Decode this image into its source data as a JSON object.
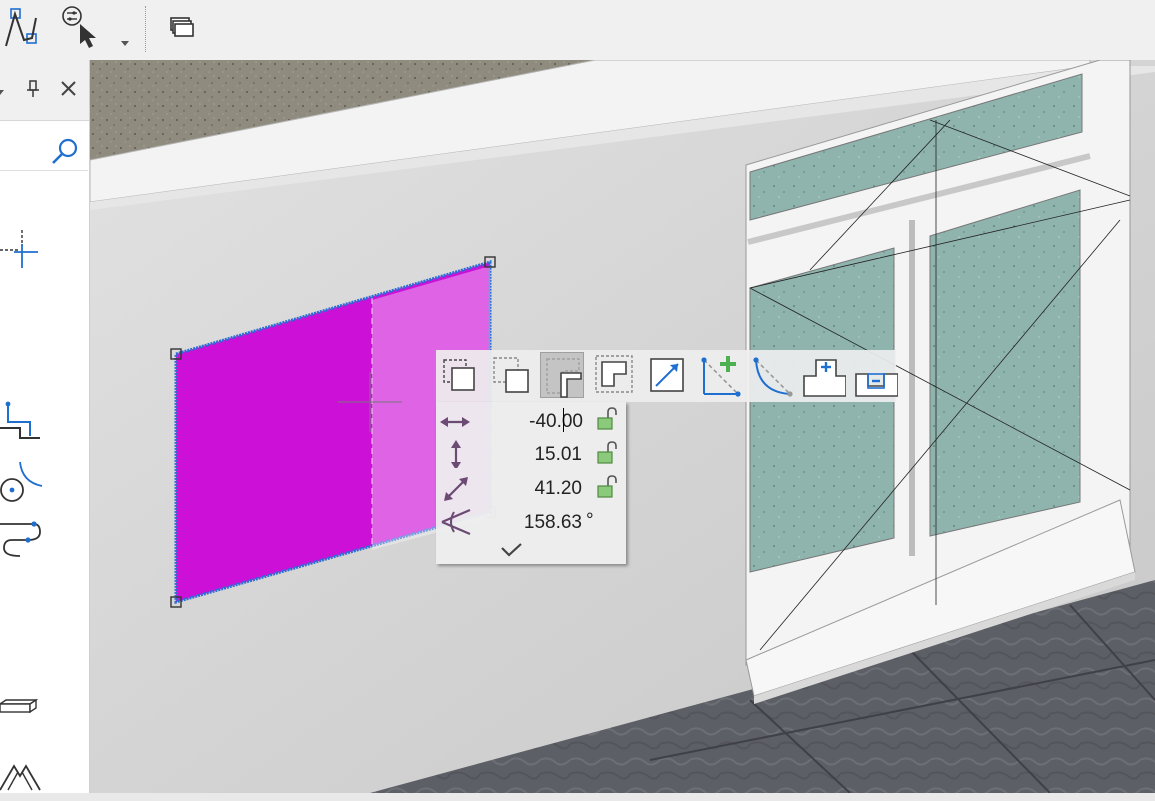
{
  "toolbar": {
    "buttons": [
      {
        "name": "polyline-tool-icon"
      },
      {
        "name": "selection-filter-icon"
      },
      {
        "name": "layers-icon"
      }
    ]
  },
  "panel": {
    "search": {
      "value": "",
      "placeholder": ""
    },
    "tools": [
      "snap-point-icon",
      "line-corner-icon",
      "arc-tool-icon",
      "spline-tool-icon",
      "slab-icon",
      "roof-icon"
    ]
  },
  "floating_toolbar": {
    "buttons": [
      {
        "name": "rectangle-select-icon",
        "active": false
      },
      {
        "name": "square-dashed-icon",
        "active": false
      },
      {
        "name": "l-shape-icon",
        "active": true
      },
      {
        "name": "offset-shape-icon",
        "active": false
      },
      {
        "name": "diagonal-icon",
        "active": false
      },
      {
        "name": "add-vertex-icon",
        "active": false
      },
      {
        "name": "curve-edge-icon",
        "active": false
      },
      {
        "name": "add-niche-icon",
        "active": false
      },
      {
        "name": "remove-niche-icon",
        "active": false
      }
    ]
  },
  "dimensions": {
    "dx": {
      "value": "-40.00",
      "locked": false
    },
    "dy": {
      "value": "15.01",
      "locked": false
    },
    "length": {
      "value": "41.20",
      "locked": false
    },
    "angle": {
      "value": "158.63",
      "unit": "°"
    }
  },
  "colors": {
    "selection": "#cc10d8",
    "selection_edge": "#2a6fd6",
    "lock_green": "#8bc97b",
    "accent_blue": "#1f6fd1"
  }
}
